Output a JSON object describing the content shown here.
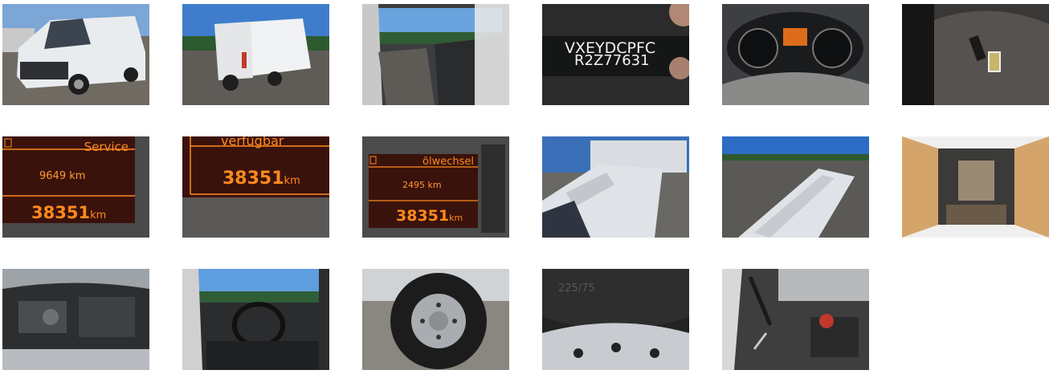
{
  "gallery": {
    "photos": [
      {
        "subject": "front-three-quarter-exterior"
      },
      {
        "subject": "rear-three-quarter-exterior"
      },
      {
        "subject": "cab-interior-passenger-side"
      },
      {
        "subject": "vin-plate",
        "vin_line1": "VXEYDCPFC",
        "vin_line2": "R2Z77631"
      },
      {
        "subject": "instrument-cluster"
      },
      {
        "subject": "key-on-seat"
      },
      {
        "subject": "dash-service-display",
        "label": "Service",
        "service_km": "9649 km",
        "odometer": "38351",
        "unit": "km"
      },
      {
        "subject": "dash-available-display",
        "label": "verfügbar",
        "odometer": "38351",
        "unit": "km"
      },
      {
        "subject": "dash-oilchange-display",
        "label": "ölwechsel",
        "oil_km": "2495 km",
        "odometer": "38351",
        "unit": "km"
      },
      {
        "subject": "roof-front"
      },
      {
        "subject": "roof-rear"
      },
      {
        "subject": "cargo-area-open-rear-doors"
      },
      {
        "subject": "engine-bay"
      },
      {
        "subject": "cab-interior-steering-wheel"
      },
      {
        "subject": "steel-wheel-tire"
      },
      {
        "subject": "tire-sidewall-closeup",
        "tire_text": "225/75"
      },
      {
        "subject": "spare-tools-in-cargo"
      }
    ]
  }
}
